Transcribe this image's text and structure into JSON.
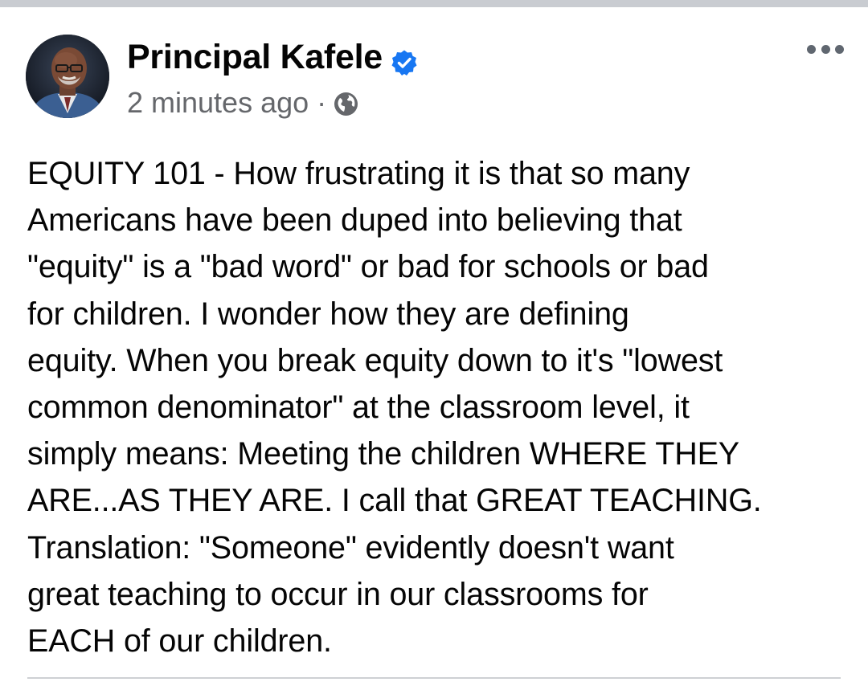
{
  "post": {
    "author_name": "Principal Kafele",
    "verified": true,
    "timestamp": "2 minutes ago",
    "separator": "·",
    "privacy_icon": "globe-icon",
    "text": "EQUITY 101 - How frustrating it is that so many\nAmericans have been duped into believing that\n\"equity\" is a \"bad word\" or bad for schools or bad\nfor children. I wonder how they are defining\nequity. When you break equity down to it's \"lowest\ncommon denominator\" at the classroom level, it\nsimply means: Meeting the children WHERE THEY\nARE...AS THEY ARE. I call that GREAT TEACHING.\nTranslation: \"Someone\" evidently doesn't want\ngreat teaching to occur in our classrooms for\nEACH of our children."
  },
  "icons": {
    "verified": "verified-badge-icon",
    "privacy": "globe-icon",
    "menu": "more-options-icon"
  },
  "colors": {
    "verified_blue": "#1877f2",
    "name_text": "#050505",
    "meta_text": "#65676b",
    "top_bar": "#c9ccd1",
    "divider": "#ced0d4"
  }
}
